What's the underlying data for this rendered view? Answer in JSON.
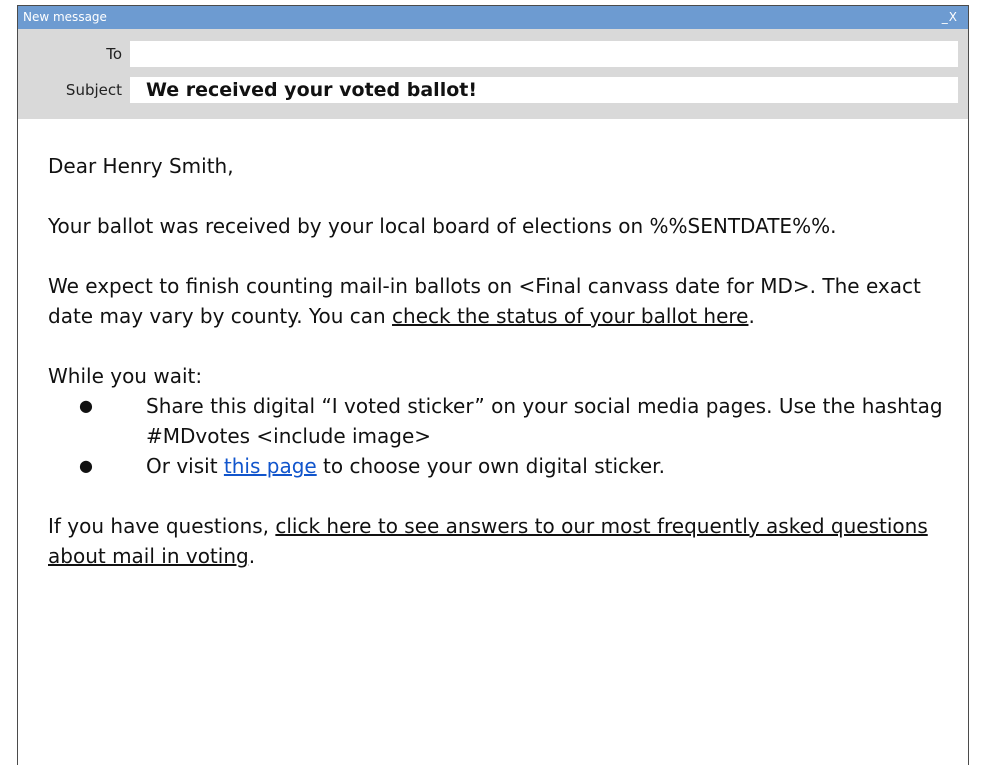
{
  "window": {
    "title": "New message",
    "minimize": "_",
    "close": "X"
  },
  "header": {
    "to_label": "To",
    "to_value": "",
    "subject_label": "Subject",
    "subject_value": "We received your voted ballot!"
  },
  "body": {
    "greeting": "Dear Henry Smith,",
    "received_text": "Your ballot was received by your local board of elections on %%SENTDATE%%.",
    "counting_text": "We expect to finish counting mail-in ballots on <Final canvass date for MD>. The exact date may vary by county. You can ",
    "status_link": "check the status of your ballot here",
    "counting_end": ".",
    "wait_heading": "While you wait:",
    "bullet_glyph": "●",
    "bullet1": "Share this digital “I voted sticker” on your social media pages. Use the hashtag #MDvotes <include image>",
    "bullet2_start": "Or visit ",
    "bullet2_link": "this page",
    "bullet2_end": " to choose your own digital sticker.",
    "questions_start": "If you have questions, ",
    "questions_link": "click here to see answers to our most frequently asked questions about mail in voting",
    "questions_end": "."
  },
  "colors": {
    "titlebar": "#6d9bd1",
    "header": "#d9d9d9",
    "link_blue": "#1155cc"
  }
}
